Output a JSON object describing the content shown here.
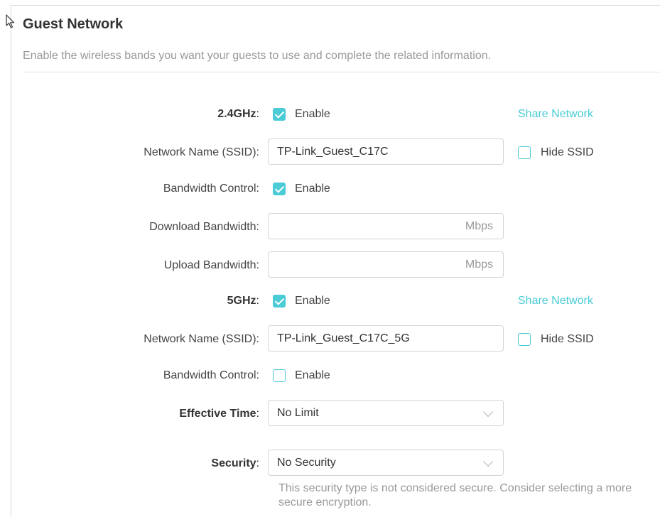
{
  "header": {
    "title": "Guest Network",
    "description": "Enable the wireless bands you want your guests to use and complete the related information."
  },
  "band24": {
    "label": "2.4GHz",
    "enable_label": "Enable",
    "enabled": true,
    "share_link": "Share Network",
    "ssid_label": "Network Name (SSID):",
    "ssid_value": "TP-Link_Guest_C17C",
    "hide_ssid_label": "Hide SSID",
    "hide_ssid": false,
    "bandwidth_control_label": "Bandwidth Control:",
    "bandwidth_control_enable_label": "Enable",
    "bandwidth_control": true,
    "download_label": "Download Bandwidth:",
    "download_value": "",
    "download_unit": "Mbps",
    "upload_label": "Upload Bandwidth:",
    "upload_value": "",
    "upload_unit": "Mbps"
  },
  "band5": {
    "label": "5GHz",
    "enable_label": "Enable",
    "enabled": true,
    "share_link": "Share Network",
    "ssid_label": "Network Name (SSID):",
    "ssid_value": "TP-Link_Guest_C17C_5G",
    "hide_ssid_label": "Hide SSID",
    "hide_ssid": false,
    "bandwidth_control_label": "Bandwidth Control:",
    "bandwidth_control_enable_label": "Enable",
    "bandwidth_control": false
  },
  "effective_time": {
    "label": "Effective Time",
    "value": "No Limit"
  },
  "security": {
    "label": "Security",
    "value": "No Security",
    "note": "This security type is not considered secure. Consider selecting a more secure encryption."
  },
  "colors": {
    "accent": "#4acbd6",
    "text": "#333333",
    "muted": "#999999",
    "border": "#d4d4d4"
  },
  "icons": {
    "cursor": "mouse-pointer-icon",
    "dropdown": "chevron-down-icon",
    "checkbox_checked": "check-icon"
  }
}
